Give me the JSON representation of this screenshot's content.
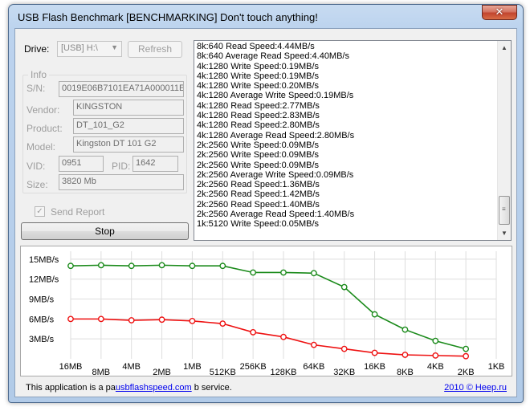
{
  "window": {
    "title": "USB Flash Benchmark [BENCHMARKING] Don't touch anything!",
    "close_glyph": "✕"
  },
  "left_panel": {
    "drive_label": "Drive:",
    "drive_value": "[USB] H:\\",
    "refresh_label": "Refresh",
    "info_title": "Info",
    "fields": {
      "sn_label": "S/N:",
      "sn_value": "0019E06B7101EA71A000011E",
      "vendor_label": "Vendor:",
      "vendor_value": "KINGSTON",
      "product_label": "Product:",
      "product_value": "DT_101_G2",
      "model_label": "Model:",
      "model_value": "Kingston DT 101 G2",
      "vid_label": "VID:",
      "vid_value": "0951",
      "pid_label": "PID:",
      "pid_value": "1642",
      "size_label": "Size:",
      "size_value": "3820 Mb"
    },
    "send_report_label": "Send Report",
    "send_report_checked": true,
    "stop_label": "Stop"
  },
  "log": {
    "lines": [
      "8k:640 Read Speed:4.44MB/s",
      "8k:640 Average Read Speed:4.40MB/s",
      "4k:1280 Write Speed:0.19MB/s",
      "4k:1280 Write Speed:0.19MB/s",
      "4k:1280 Write Speed:0.20MB/s",
      "4k:1280 Average Write Speed:0.19MB/s",
      "4k:1280 Read Speed:2.77MB/s",
      "4k:1280 Read Speed:2.83MB/s",
      "4k:1280 Read Speed:2.80MB/s",
      "4k:1280 Average Read Speed:2.80MB/s",
      "2k:2560 Write Speed:0.09MB/s",
      "2k:2560 Write Speed:0.09MB/s",
      "2k:2560 Write Speed:0.09MB/s",
      "2k:2560 Average Write Speed:0.09MB/s",
      "2k:2560 Read Speed:1.36MB/s",
      "2k:2560 Read Speed:1.42MB/s",
      "2k:2560 Read Speed:1.40MB/s",
      "2k:2560 Average Read Speed:1.40MB/s",
      "1k:5120 Write Speed:0.05MB/s"
    ]
  },
  "chart_data": {
    "type": "line",
    "categories": [
      "16MB",
      "8MB",
      "4MB",
      "2MB",
      "1MB",
      "512KB",
      "256KB",
      "128KB",
      "64KB",
      "32KB",
      "16KB",
      "8KB",
      "4KB",
      "2KB",
      "1KB"
    ],
    "y_tick_labels": [
      "15MB/s",
      "12MB/s",
      "9MB/s",
      "6MB/s",
      "3MB/s"
    ],
    "y_ticks": [
      15,
      12,
      9,
      6,
      3
    ],
    "ylim": [
      0,
      16.2
    ],
    "grid": true,
    "series": [
      {
        "color": "#1a8a1a",
        "values": [
          14.0,
          14.1,
          14.0,
          14.1,
          14.0,
          14.0,
          13.0,
          13.0,
          12.9,
          10.8,
          6.7,
          4.4,
          2.7,
          1.5
        ]
      },
      {
        "color": "#ee1111",
        "values": [
          6.0,
          6.0,
          5.8,
          5.9,
          5.7,
          5.3,
          4.0,
          3.3,
          2.1,
          1.5,
          0.9,
          0.6,
          0.5,
          0.4
        ]
      }
    ]
  },
  "footer": {
    "text_before": "This application is a pa",
    "link": "usbflashspeed.com",
    "text_after": " b service.",
    "copyright": "2010 © Heep.ru"
  }
}
